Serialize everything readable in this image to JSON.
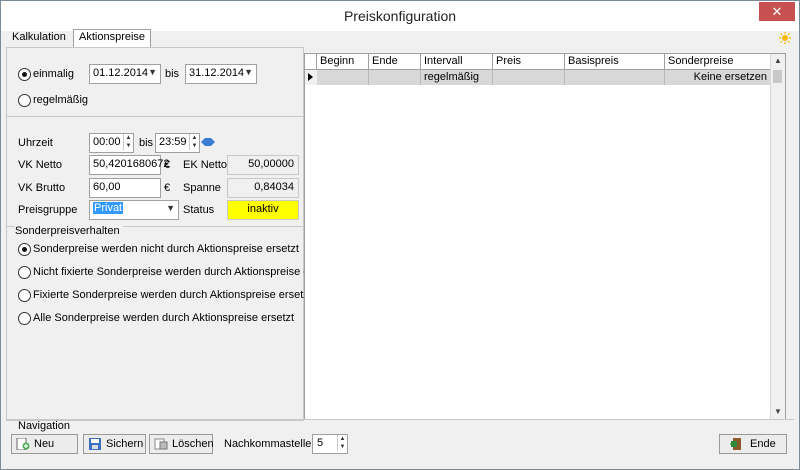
{
  "window": {
    "title": "Preiskonfiguration",
    "close_glyph": "✕"
  },
  "tabs": [
    {
      "label": "Kalkulation",
      "active": false
    },
    {
      "label": "Aktionspreise",
      "active": true
    }
  ],
  "period": {
    "once_label": "einmalig",
    "recurring_label": "regelmäßig",
    "selected": "einmalig",
    "from_date": "01.12.2014",
    "to_label": "bis",
    "to_date": "31.12.2014"
  },
  "time": {
    "label": "Uhrzeit",
    "from": "00:00",
    "to_label": "bis",
    "to": "23:59"
  },
  "prices": {
    "vk_netto_label": "VK Netto",
    "vk_netto": "50,4201680672",
    "vk_netto_currency": "€",
    "ek_netto_label": "EK Netto",
    "ek_netto": "50,00000",
    "vk_brutto_label": "VK Brutto",
    "vk_brutto": "60,00",
    "vk_brutto_currency": "€",
    "spanne_label": "Spanne",
    "spanne": "0,84034",
    "preisgruppe_label": "Preisgruppe",
    "preisgruppe": "Privat",
    "status_label": "Status",
    "status": "inaktiv",
    "status_color": "#ffff00"
  },
  "sonderpreis": {
    "title": "Sonderpreisverhalten",
    "options": [
      "Sonderpreise werden nicht durch Aktionspreise ersetzt",
      "Nicht fixierte Sonderpreise werden durch Aktionspreise ersetzt",
      "Fixierte Sonderpreise werden durch Aktionspreise ersetzt",
      "Alle Sonderpreise werden durch Aktionspreise ersetzt"
    ],
    "selected_index": 0
  },
  "grid": {
    "columns": [
      "Beginn",
      "Ende",
      "Intervall",
      "Preis",
      "Basispreis",
      "Sonderpreise"
    ],
    "rows": [
      {
        "beginn": "",
        "ende": "",
        "intervall": "regelmäßig",
        "preis": "",
        "basispreis": "",
        "sonderpreise": "Keine ersetzen"
      }
    ]
  },
  "navigation": {
    "title": "Navigation",
    "new_label": "Neu",
    "save_label": "Sichern",
    "delete_label": "Löschen",
    "decimals_label": "Nachkommastellen",
    "decimals_value": "5",
    "end_label": "Ende"
  }
}
